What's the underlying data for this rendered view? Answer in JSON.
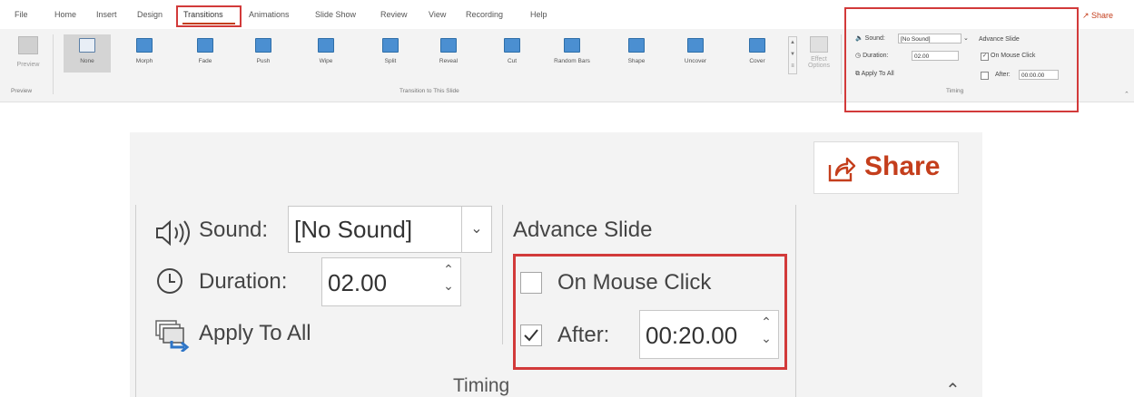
{
  "menu": {
    "tabs": [
      "File",
      "Home",
      "Insert",
      "Design",
      "Transitions",
      "Animations",
      "Slide Show",
      "Review",
      "View",
      "Recording",
      "Help"
    ],
    "active_tab": "Transitions",
    "share": "Share"
  },
  "ribbon": {
    "preview_label": "Preview",
    "preview_group_label": "Preview",
    "transitions": [
      "None",
      "Morph",
      "Fade",
      "Push",
      "Wipe",
      "Split",
      "Reveal",
      "Cut",
      "Random Bars",
      "Shape",
      "Uncover",
      "Cover"
    ],
    "selected_transition": "None",
    "transition_group_label": "Transition to This Slide",
    "effect_options_label": "Effect Options",
    "timing_group_label": "Timing"
  },
  "timing_small": {
    "sound_label": "Sound:",
    "sound_value": "[No Sound]",
    "duration_label": "Duration:",
    "duration_value": "02.00",
    "apply_label": "Apply To All",
    "advance_label": "Advance Slide",
    "on_click_label": "On Mouse Click",
    "on_click_checked": true,
    "after_label": "After:",
    "after_value": "00:00.00",
    "after_checked": false
  },
  "zoom": {
    "share_label": "Share",
    "sound_label": "Sound:",
    "sound_value": "[No Sound]",
    "duration_label": "Duration:",
    "duration_value": "02.00",
    "apply_label": "Apply To All",
    "advance_label": "Advance Slide",
    "on_click_label": "On Mouse Click",
    "on_click_checked": false,
    "after_label": "After:",
    "after_value": "00:20.00",
    "after_checked": true,
    "timing_label": "Timing"
  },
  "colors": {
    "accent": "#c43e1c",
    "highlight_box": "#d23a3a",
    "ribbon_bg": "#f3f3f3"
  }
}
